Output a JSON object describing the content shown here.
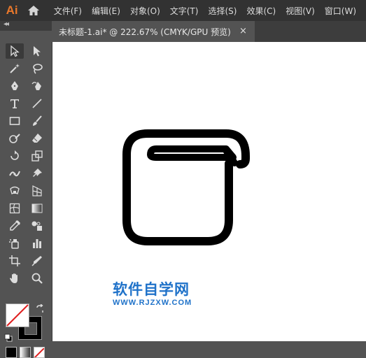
{
  "app": {
    "logo": "Ai"
  },
  "menu": [
    "文件(F)",
    "编辑(E)",
    "对象(O)",
    "文字(T)",
    "选择(S)",
    "效果(C)",
    "视图(V)",
    "窗口(W)"
  ],
  "document_tab": {
    "title": "未标题-1.ai* @ 222.67% (CMYK/GPU 预览)",
    "close": "×"
  },
  "toolbar_grip": "◂◂",
  "watermark": {
    "chinese": "软件自学网",
    "url": "WWW.RJZXW.COM"
  },
  "colors": {
    "accent": "#e9782b",
    "watermark": "#1f72c9",
    "canvas": "#ffffff",
    "ui_bg": "#535353"
  }
}
